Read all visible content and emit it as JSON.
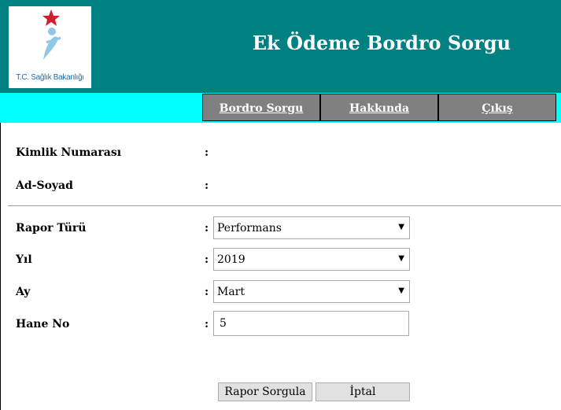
{
  "header": {
    "logo_caption": "T.C. Sağlık Bakanlığı",
    "title": "Ek Ödeme Bordro Sorgu",
    "background_color": "#008080"
  },
  "nav": {
    "background_color": "#00ffff",
    "items": [
      {
        "label": "Bordro Sorgu"
      },
      {
        "label": "Hakkında"
      },
      {
        "label": "Çıkış"
      }
    ]
  },
  "form": {
    "colon": ":",
    "identity": {
      "kimlik_label": "Kimlik Numarası",
      "kimlik_value": "",
      "adsoyad_label": "Ad-Soyad",
      "adsoyad_value": ""
    },
    "rapor_turu": {
      "label": "Rapor Türü",
      "value": "Performans"
    },
    "yil": {
      "label": "Yıl",
      "value": "2019"
    },
    "ay": {
      "label": "Ay",
      "value": "Mart"
    },
    "hane_no": {
      "label": "Hane No",
      "value": "5"
    },
    "buttons": {
      "submit_label": "Rapor Sorgula",
      "cancel_label": "İptal"
    }
  }
}
